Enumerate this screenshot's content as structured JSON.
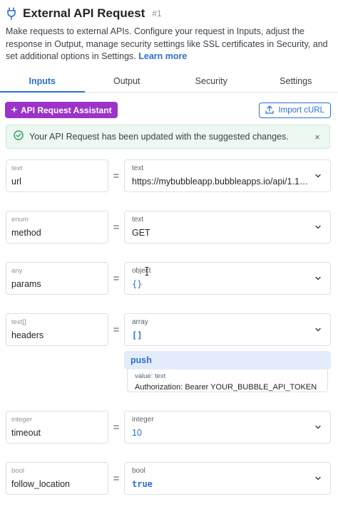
{
  "header": {
    "title": "External API Request",
    "number": "#1",
    "icon": "plug-icon"
  },
  "description": {
    "text": "Make requests to external APIs. Configure your request in Inputs, adjust the response in Output, manage security settings like SSL certificates in Security, and set additional options in Settings.",
    "link": "Learn more"
  },
  "tabs": [
    {
      "label": "Inputs",
      "active": true
    },
    {
      "label": "Output",
      "active": false
    },
    {
      "label": "Security",
      "active": false
    },
    {
      "label": "Settings",
      "active": false
    }
  ],
  "toolbar": {
    "assistant_label": "API Request Assistant",
    "import_label": "Import cURL"
  },
  "alert": {
    "message": "Your API Request has been updated with the suggested changes.",
    "close": "×"
  },
  "fields": [
    {
      "left_type": "text",
      "name": "url",
      "right_type": "text",
      "value": "https://mybubbleapp.bubbleapps.io/api/1.1/o..."
    },
    {
      "left_type": "enum",
      "name": "method",
      "right_type": "text",
      "value": "GET"
    },
    {
      "left_type": "any",
      "name": "params",
      "right_type": "object",
      "value": "{}"
    },
    {
      "left_type": "text[]",
      "name": "headers",
      "right_type": "array",
      "value": "[]"
    },
    {
      "left_type": "integer",
      "name": "timeout",
      "right_type": "integer",
      "value": "10"
    },
    {
      "left_type": "bool",
      "name": "follow_location",
      "right_type": "bool",
      "value": "true"
    }
  ],
  "equals": "=",
  "push": {
    "label": "push",
    "item_type": "value: text",
    "item_value": "Authorization: Bearer YOUR_BUBBLE_API_TOKEN"
  },
  "colors": {
    "accent": "#2c6fd6",
    "assistant": "#9b33c9",
    "success_bg": "#ecf8f1",
    "success_icon": "#2f9e5b"
  }
}
